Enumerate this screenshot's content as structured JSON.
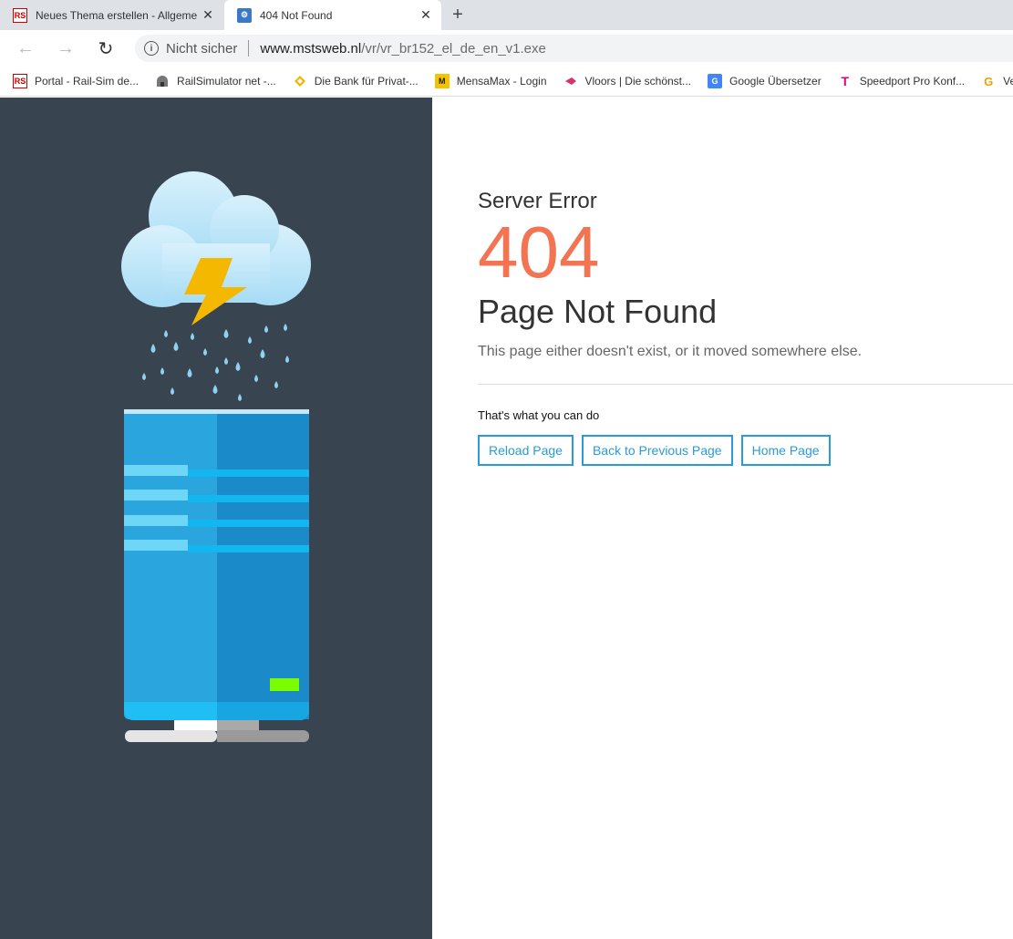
{
  "browser": {
    "tabs": [
      {
        "title": "Neues Thema erstellen - Allgeme",
        "favicon": "RS",
        "active": false
      },
      {
        "title": "404 Not Found",
        "active": true
      }
    ],
    "address_bar": {
      "security_text": "Nicht sicher",
      "host": "www.mstsweb.nl",
      "path": "/vr/vr_br152_el_de_en_v1.exe"
    },
    "bookmarks": [
      {
        "label": "Portal - Rail-Sim de...",
        "icon": "RS",
        "color": "#cc0000"
      },
      {
        "label": "RailSimulator net -...",
        "icon": "tunnel-icon",
        "color": "#666666"
      },
      {
        "label": "Die Bank für Privat-...",
        "icon": "diamond-icon",
        "color": "#f0b400"
      },
      {
        "label": "MensaMax - Login",
        "icon": "M",
        "color": "#f5c400"
      },
      {
        "label": "Vloors | Die schönst...",
        "icon": "chevron-icon",
        "color": "#d6336c"
      },
      {
        "label": "Google Übersetzer",
        "icon": "G",
        "color": "#4285f4"
      },
      {
        "label": "Speedport Pro Konf...",
        "icon": "T",
        "color": "#e20074"
      },
      {
        "label": "Verd",
        "icon": "G",
        "color": "#f0a000"
      }
    ]
  },
  "page": {
    "server_error": "Server Error",
    "code": "404",
    "headline": "Page Not Found",
    "description": "This page either doesn't exist, or it moved somewhere else.",
    "actions_heading": "That's what you can do",
    "buttons": {
      "reload": "Reload Page",
      "back": "Back to Previous Page",
      "home": "Home Page"
    }
  },
  "colors": {
    "left_panel": "#38444f",
    "accent": "#f27452",
    "button": "#2a9bd6"
  }
}
